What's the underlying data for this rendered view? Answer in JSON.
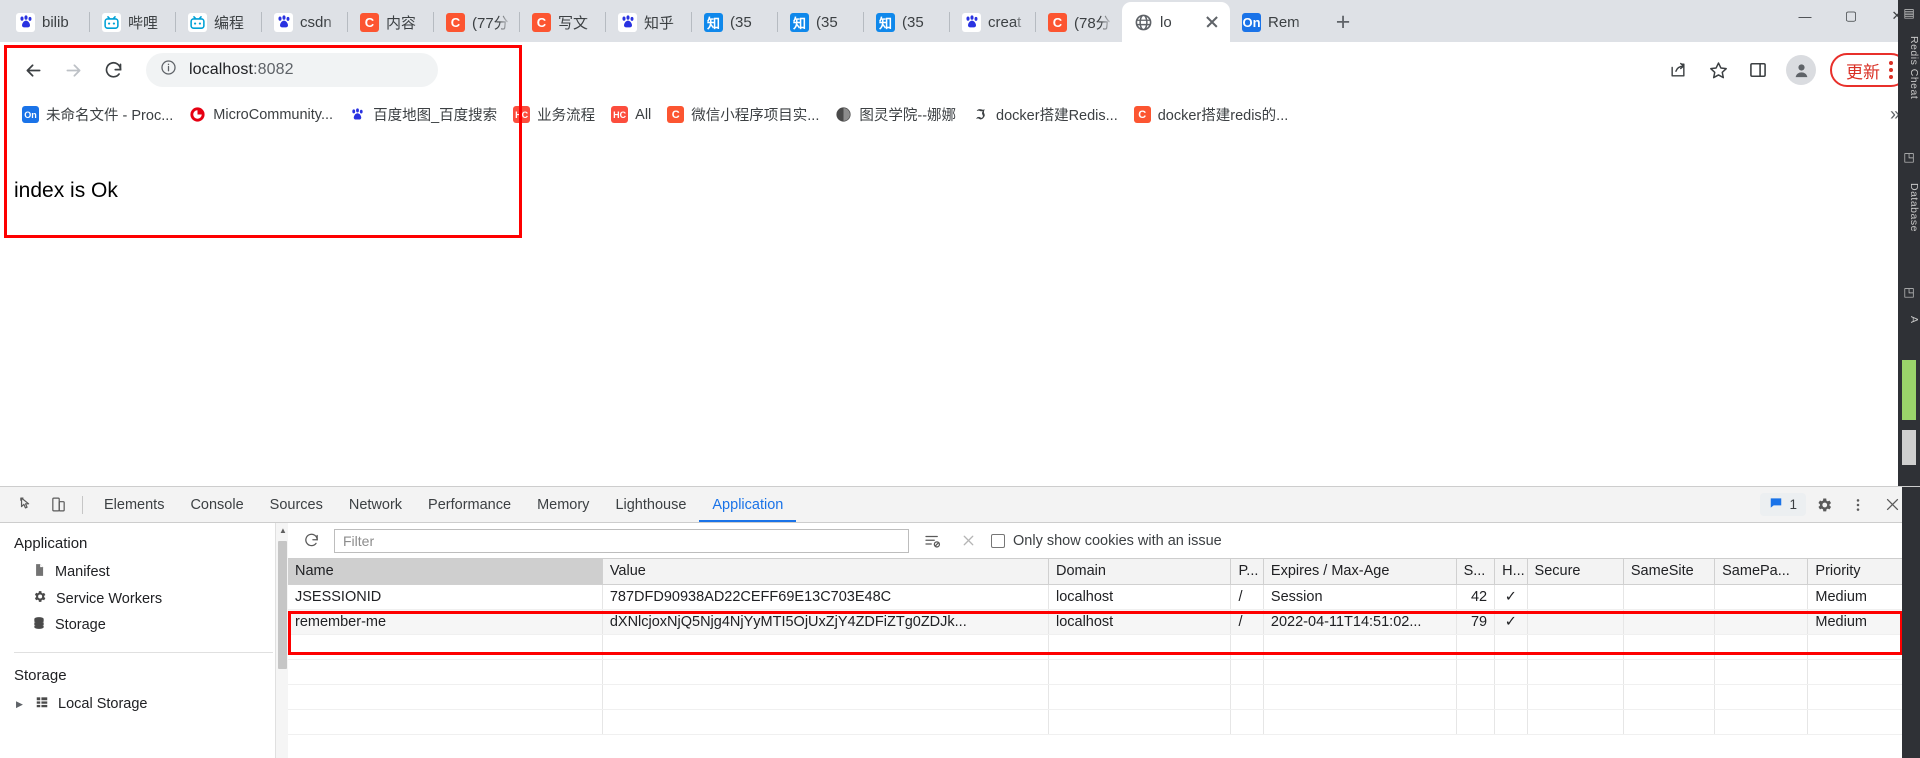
{
  "tabs": [
    {
      "label": "bilib",
      "icon": "baidu-paw-icon",
      "kind": "baidu"
    },
    {
      "label": "哔哩",
      "icon": "bilibili-icon",
      "kind": "bili"
    },
    {
      "label": "编程",
      "icon": "bilibili-icon",
      "kind": "bili"
    },
    {
      "label": "csdn",
      "icon": "baidu-paw-icon",
      "kind": "baidu"
    },
    {
      "label": "内容",
      "icon": "csdn-icon",
      "kind": "csdn"
    },
    {
      "label": "(77分",
      "icon": "csdn-icon",
      "kind": "csdn"
    },
    {
      "label": "写文",
      "icon": "csdn-icon",
      "kind": "csdn"
    },
    {
      "label": "知乎",
      "icon": "baidu-paw-icon",
      "kind": "baidu"
    },
    {
      "label": "(35 ",
      "icon": "zhihu-icon",
      "kind": "zhihu"
    },
    {
      "label": "(35 ",
      "icon": "zhihu-icon",
      "kind": "zhihu"
    },
    {
      "label": "(35 ",
      "icon": "zhihu-icon",
      "kind": "zhihu"
    },
    {
      "label": "creat",
      "icon": "baidu-paw-icon",
      "kind": "baidu"
    },
    {
      "label": "(78分",
      "icon": "csdn-icon",
      "kind": "csdn"
    }
  ],
  "active_tab": {
    "label": "lo",
    "icon": "globe-icon",
    "close": "×"
  },
  "pinned_tab": {
    "label": "Rem",
    "icon": "onenote-icon",
    "badge": "On"
  },
  "new_tab_label": "+",
  "window_controls": {
    "minimize": "—",
    "maximize": "▢",
    "close": "✕"
  },
  "toolbar": {
    "back": "←",
    "forward": "→",
    "reload": "⟳",
    "site_info_icon": "info-circle-icon",
    "url_host": "localhost",
    "url_port": ":8082",
    "share_icon": "share-icon",
    "bookmark_icon": "star-icon",
    "sidepanel_icon": "side-panel-icon",
    "profile_icon": "profile-avatar-icon",
    "update_label": "更新",
    "menu_icon": "kebab-menu-icon"
  },
  "bookmarks": {
    "items": [
      {
        "label": "未命名文件 - Proc...",
        "icon": "onenote-icon",
        "kind": "one"
      },
      {
        "label": "MicroCommunity...",
        "icon": "microcommunity-icon",
        "kind": "mc"
      },
      {
        "label": "百度地图_百度搜索",
        "icon": "baidu-paw-icon",
        "kind": "baidu"
      },
      {
        "label": "业务流程",
        "icon": "hc-icon",
        "kind": "hc"
      },
      {
        "label": "All",
        "icon": "hc-icon",
        "kind": "hc"
      },
      {
        "label": "微信小程序项目实...",
        "icon": "csdn-icon",
        "kind": "csdn"
      },
      {
        "label": "图灵学院--娜娜",
        "icon": "tuling-icon",
        "kind": "tuling"
      },
      {
        "label": "docker搭建Redis...",
        "icon": "script-icon",
        "kind": "script"
      },
      {
        "label": "docker搭建redis的...",
        "icon": "csdn-icon",
        "kind": "csdn"
      }
    ],
    "overflow": "»"
  },
  "page": {
    "body_text": "index is Ok"
  },
  "devtools": {
    "inspect_icon": "inspect-element-icon",
    "device_icon": "device-toolbar-icon",
    "tabs": [
      {
        "label": "Elements",
        "selected": false
      },
      {
        "label": "Console",
        "selected": false
      },
      {
        "label": "Sources",
        "selected": false
      },
      {
        "label": "Network",
        "selected": false
      },
      {
        "label": "Performance",
        "selected": false
      },
      {
        "label": "Memory",
        "selected": false
      },
      {
        "label": "Lighthouse",
        "selected": false
      },
      {
        "label": "Application",
        "selected": true
      }
    ],
    "message_count": "1",
    "message_icon": "message-bubble-icon",
    "settings_icon": "gear-icon",
    "more_icon": "kebab-menu-icon",
    "close_icon": "close-icon",
    "sidebar": {
      "section_application": "Application",
      "app_items": [
        {
          "label": "Manifest",
          "icon": "manifest-icon"
        },
        {
          "label": "Service Workers",
          "icon": "gear-icon"
        },
        {
          "label": "Storage",
          "icon": "database-icon"
        }
      ],
      "section_storage": "Storage",
      "storage_items": [
        {
          "label": "Local Storage",
          "icon": "grid-icon",
          "caret": "▶"
        }
      ]
    },
    "cookie_toolbar": {
      "refresh_icon": "refresh-icon",
      "filter_placeholder": "Filter",
      "clear_filter_icon": "filter-clear-icon",
      "clear_all_icon": "clear-all-icon",
      "issue_checkbox_label": "Only show cookies with an issue",
      "issue_checked": false
    },
    "cookie_table": {
      "columns": [
        "Name",
        "Value",
        "Domain",
        "P...",
        "Expires / Max-Age",
        "S...",
        "H...",
        "Secure",
        "SameSite",
        "SamePa...",
        "Priority"
      ],
      "sorted_column": "Name",
      "rows": [
        {
          "name": "JSESSIONID",
          "value": "787DFD90938AD22CEFF69E13C703E48C",
          "domain": "localhost",
          "path": "/",
          "expires": "Session",
          "size": "42",
          "httponly": "✓",
          "secure": "",
          "samesite": "",
          "sameparty": "",
          "priority": "Medium",
          "highlighted": false
        },
        {
          "name": "remember-me",
          "value": "dXNlcjoxNjQ5Njg4NjYyMTI5OjUxZjY4ZDFiZTg0ZDJk...",
          "domain": "localhost",
          "path": "/",
          "expires": "2022-04-11T14:51:02...",
          "size": "79",
          "httponly": "✓",
          "secure": "",
          "samesite": "",
          "sameparty": "",
          "priority": "Medium",
          "highlighted": true
        }
      ]
    }
  },
  "right_rail": {
    "labels": [
      "Redis Cheat",
      "Database",
      "A"
    ]
  },
  "colors": {
    "accent": "#1a73e8",
    "highlight_red": "#fe0000",
    "update_red": "#d93025",
    "csdn_orange": "#fc5531",
    "zhihu_blue": "#0f88eb",
    "tabstrip_bg": "#dee1e6"
  }
}
